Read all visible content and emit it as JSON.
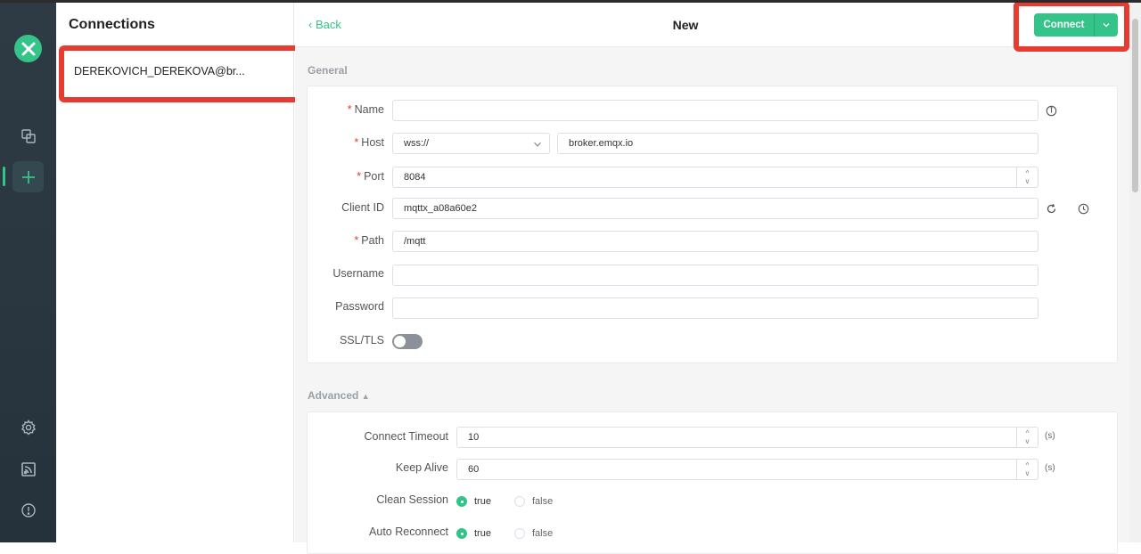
{
  "sidebar_rail": {
    "logo": "mqttx-logo",
    "items": [
      {
        "name": "connections-icon"
      },
      {
        "name": "new-connection-icon",
        "active": true
      },
      {
        "name": "settings-icon"
      },
      {
        "name": "feed-icon"
      },
      {
        "name": "about-icon"
      }
    ]
  },
  "connections": {
    "title": "Connections",
    "items": [
      {
        "label": "DEREKOVICH_DEREKOVA@br..."
      }
    ]
  },
  "header": {
    "back_label": "Back",
    "title": "New",
    "connect_label": "Connect"
  },
  "general": {
    "section_label": "General",
    "name": {
      "label": "Name",
      "required": true,
      "value": ""
    },
    "host": {
      "label": "Host",
      "required": true,
      "protocol": "wss://",
      "value": "broker.emqx.io"
    },
    "port": {
      "label": "Port",
      "required": true,
      "value": "8084"
    },
    "client_id": {
      "label": "Client ID",
      "required": false,
      "value": "mqttx_a08a60e2"
    },
    "path": {
      "label": "Path",
      "required": true,
      "value": "/mqtt"
    },
    "username": {
      "label": "Username",
      "value": ""
    },
    "password": {
      "label": "Password",
      "value": ""
    },
    "ssl": {
      "label": "SSL/TLS",
      "enabled": false
    }
  },
  "advanced": {
    "section_label": "Advanced",
    "connect_timeout": {
      "label": "Connect Timeout",
      "value": "10",
      "unit": "(s)"
    },
    "keep_alive": {
      "label": "Keep Alive",
      "value": "60",
      "unit": "(s)"
    },
    "clean_session": {
      "label": "Clean Session",
      "options": [
        "true",
        "false"
      ],
      "selected": "true"
    },
    "auto_reconnect": {
      "label": "Auto Reconnect",
      "options": [
        "true",
        "false"
      ],
      "selected": "true"
    }
  },
  "colors": {
    "accent": "#34c388",
    "highlight": "#e53b30",
    "rail": "#2e3b45"
  }
}
